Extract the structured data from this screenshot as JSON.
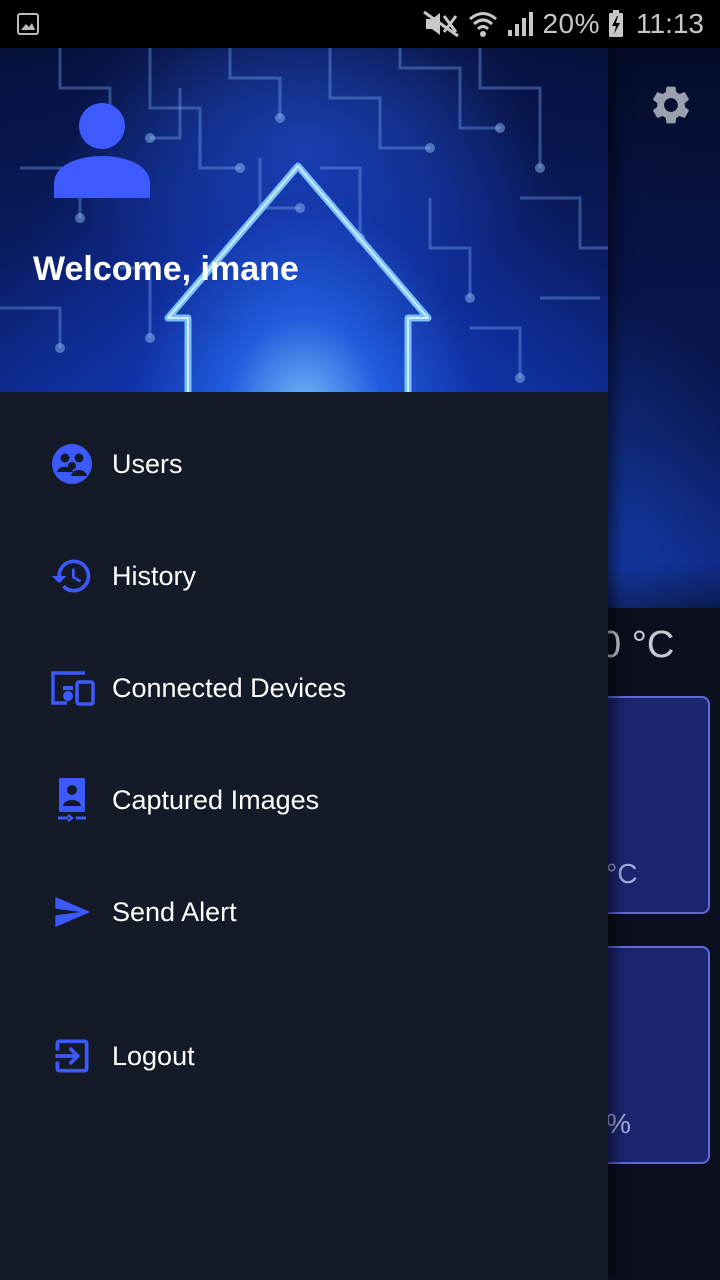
{
  "status_bar": {
    "battery_percent": "20%",
    "time": "11:13",
    "icons": [
      "gallery-notification-icon",
      "mute-icon",
      "wifi-icon",
      "signal-icon",
      "battery-charging-icon"
    ]
  },
  "drawer": {
    "welcome_text": "Welcome, imane",
    "avatar_icon": "person-icon",
    "items": [
      {
        "label": "Users",
        "icon": "users-icon"
      },
      {
        "label": "History",
        "icon": "history-icon"
      },
      {
        "label": "Connected Devices",
        "icon": "devices-icon"
      },
      {
        "label": "Captured Images",
        "icon": "portrait-icon"
      },
      {
        "label": "Send Alert",
        "icon": "send-icon"
      },
      {
        "label": "Logout",
        "icon": "logout-icon"
      }
    ]
  },
  "background": {
    "temperature_fragment": "0 °C",
    "card1_fragment": "°C",
    "card2_fragment": "%",
    "settings_icon": "gear-icon"
  },
  "colors": {
    "accent": "#3d5afe",
    "drawer_bg": "#141a27",
    "card_bg": "#1b2570"
  }
}
